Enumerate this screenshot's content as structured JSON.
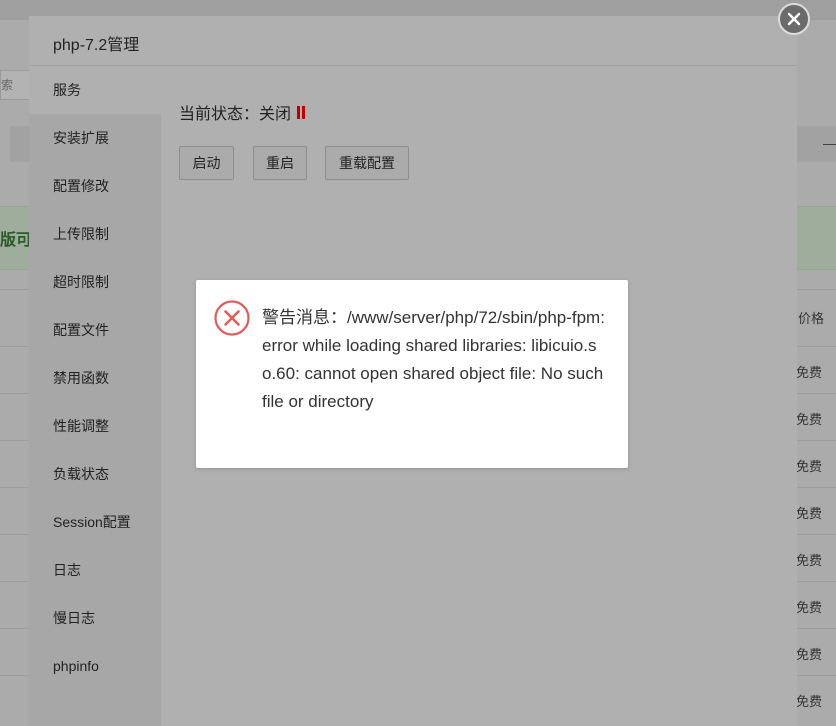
{
  "window_title": "php-7.2管理",
  "sidebar": {
    "items": [
      {
        "label": "服务",
        "active": true
      },
      {
        "label": "安装扩展"
      },
      {
        "label": "配置修改"
      },
      {
        "label": "上传限制"
      },
      {
        "label": "超时限制"
      },
      {
        "label": "配置文件"
      },
      {
        "label": "禁用函数"
      },
      {
        "label": "性能调整"
      },
      {
        "label": "负载状态"
      },
      {
        "label": "Session配置"
      },
      {
        "label": "日志"
      },
      {
        "label": "慢日志"
      },
      {
        "label": "phpinfo"
      }
    ]
  },
  "service": {
    "status_label": "当前状态：",
    "status_value": "关闭",
    "status_icon": "pause-icon",
    "status_color": "#c00000",
    "buttons": {
      "start": "启动",
      "restart": "重启",
      "reload": "重载配置"
    }
  },
  "alert": {
    "icon": "error-circle-icon",
    "icon_color": "#e45b5b",
    "message": "警告消息：/www/server/php/72/sbin/php-fpm: error while loading shared libraries: libicuio.so.60: cannot open shared object file: No such file or directory"
  },
  "background": {
    "search_fragment": "索",
    "dash_fragment": "—",
    "green_banner_fragment": "版可",
    "price_header": "价格",
    "free_label": "免费"
  }
}
